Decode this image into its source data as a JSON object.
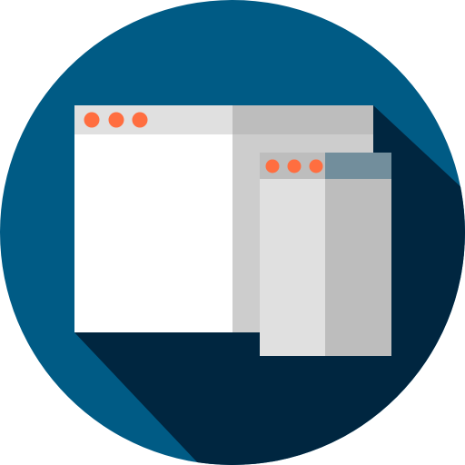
{
  "icon": {
    "name": "browser-windows-icon",
    "colors": {
      "circle": "#005B85",
      "shadow": "#002640",
      "window_large_body": "#FFFFFF",
      "window_large_bar": "#E0E0E0",
      "window_large_right_panel": "#CDCDCD",
      "window_large_right_bar": "#BDBDBD",
      "window_small_body": "#E0E0E0",
      "window_small_bar": "#BDBDBD",
      "window_small_right_panel": "#BDBDBD",
      "window_small_right_bar": "#728E9C",
      "dots": "#FF6E40"
    }
  }
}
